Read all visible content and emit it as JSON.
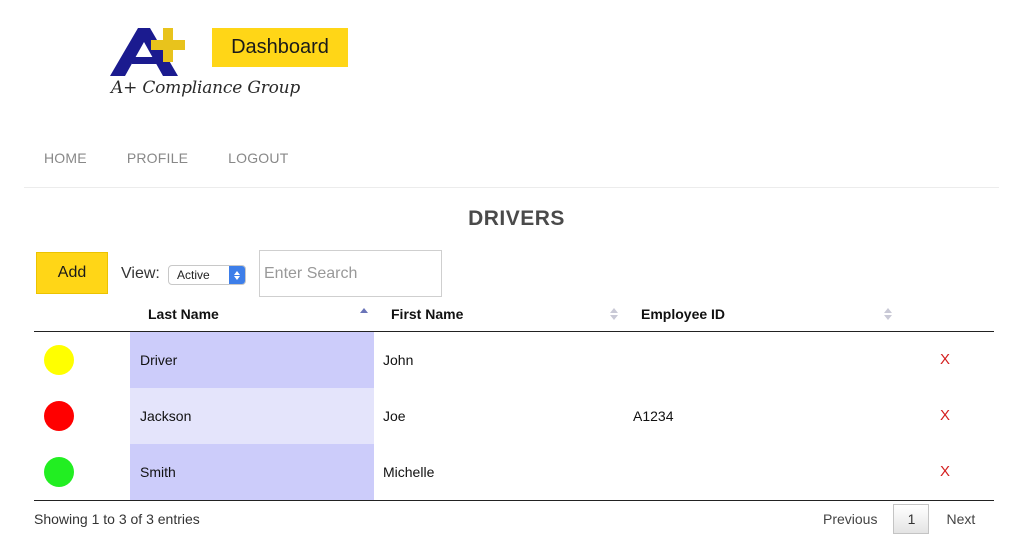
{
  "header": {
    "logo_text": "A+ Compliance Group",
    "dashboard_label": "Dashboard"
  },
  "nav": {
    "home": "HOME",
    "profile": "PROFILE",
    "logout": "LOGOUT"
  },
  "page": {
    "title": "DRIVERS"
  },
  "toolbar": {
    "add_label": "Add",
    "view_label": "View:",
    "view_value": "Active",
    "search_placeholder": "Enter Search"
  },
  "table": {
    "columns": {
      "last_name": "Last Name",
      "first_name": "First Name",
      "employee_id": "Employee ID"
    },
    "rows": [
      {
        "status_color": "#ffff00",
        "last_name": "Driver",
        "first_name": "John",
        "employee_id": "",
        "delete": "X"
      },
      {
        "status_color": "#ff0000",
        "last_name": "Jackson",
        "first_name": "Joe",
        "employee_id": "A1234",
        "delete": "X"
      },
      {
        "status_color": "#22ee22",
        "last_name": "Smith",
        "first_name": "Michelle",
        "employee_id": "",
        "delete": "X"
      }
    ]
  },
  "footer": {
    "info": "Showing 1 to 3 of 3 entries",
    "previous": "Previous",
    "page": "1",
    "next": "Next"
  },
  "colors": {
    "brand_yellow": "#ffd617",
    "logo_blue": "#1b1b8f",
    "logo_gold": "#e8c31c",
    "sorted_column": "#ccccfa",
    "delete_red": "#d42020"
  }
}
